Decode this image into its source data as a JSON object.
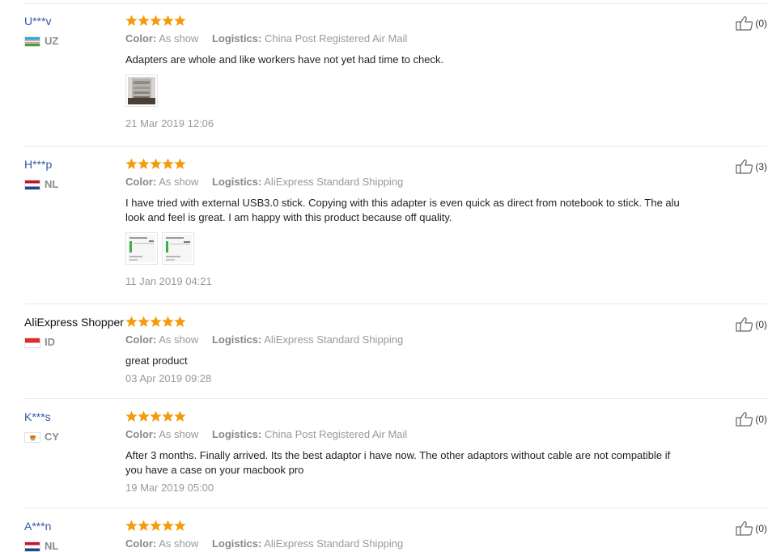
{
  "labels": {
    "color": "Color:",
    "logistics": "Logistics:"
  },
  "colors": {
    "star": "#f59a0a",
    "username_link": "#2f59a7",
    "meta_text": "#999999",
    "divider": "#e8e8e8"
  },
  "icons": {
    "rating": "star-icon",
    "helpful": "thumbs-up-icon"
  },
  "reviews": [
    {
      "user": "U***v",
      "country": "UZ",
      "rating": 5,
      "color": "As show",
      "logistics": "China Post Registered Air Mail",
      "text": "Adapters are whole and like workers have not yet had time to check.",
      "photos": 1,
      "date": "21 Mar 2019 12:06",
      "helpful": "(0)"
    },
    {
      "user": "H***p",
      "country": "NL",
      "rating": 5,
      "color": "As show",
      "logistics": "AliExpress Standard Shipping",
      "text": "I have tried with external USB3.0 stick. Copying with this adapter is even quick as direct from notebook to stick. The alu look and feel is great. I am happy with this product because off quality.",
      "photos": 2,
      "date": "11 Jan 2019 04:21",
      "helpful": "(3)"
    },
    {
      "user": "AliExpress Shopper",
      "country": "ID",
      "rating": 5,
      "color": "As show",
      "logistics": "AliExpress Standard Shipping",
      "text": "great product",
      "photos": 0,
      "date": "03 Apr 2019 09:28",
      "helpful": "(0)"
    },
    {
      "user": "K***s",
      "country": "CY",
      "rating": 5,
      "color": "As show",
      "logistics": "China Post Registered Air Mail",
      "text": "After 3 months. Finally arrived. Its the best adaptor i have now. The other adaptors without cable are not compatible if you have a case on your macbook pro",
      "photos": 0,
      "date": "19 Mar 2019 05:00",
      "helpful": "(0)"
    },
    {
      "user": "A***n",
      "country": "NL",
      "rating": 5,
      "color": "As show",
      "logistics": "AliExpress Standard Shipping",
      "text": "",
      "photos": 0,
      "date": "",
      "helpful": "(0)"
    }
  ]
}
